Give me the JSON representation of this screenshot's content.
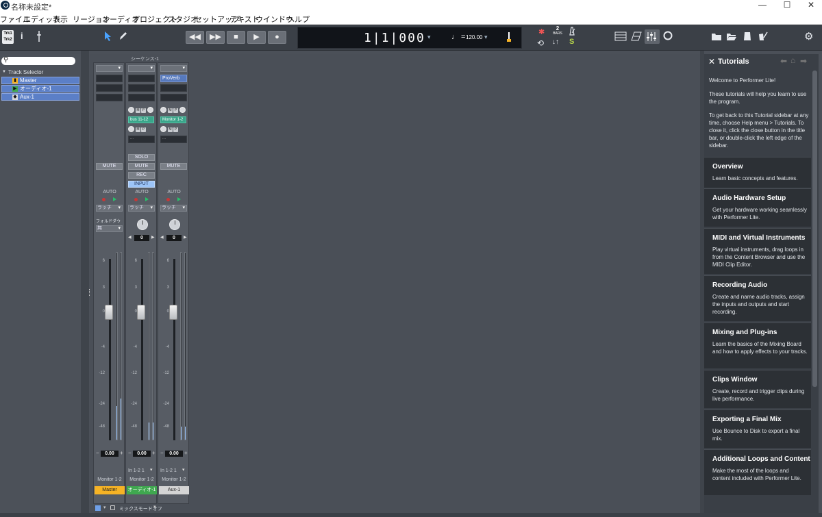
{
  "window": {
    "title": "名称未設定*",
    "controls": [
      "—",
      "☐",
      "✕"
    ]
  },
  "menu": [
    "ファイル",
    "エディット",
    "表示",
    "リージョン",
    "オーディオ",
    "プロジェクト",
    "スタジオ",
    "セットアップ",
    "テキスト",
    "ウインドウ",
    "ヘルプ"
  ],
  "toolbar": {
    "trk_label_top": "Trk1",
    "trk_label_bottom": "Trk2",
    "info_label": "i",
    "time_position": "1|1|000",
    "time_dropdown": "▾",
    "tempo": "120.00",
    "bars_count": "2",
    "bars_label": "BARS",
    "s_label": "S"
  },
  "track_selector": {
    "search_placeholder": "",
    "label": "Track Selector",
    "tracks": [
      {
        "name": "Master",
        "color": "#f6b325"
      },
      {
        "name": "オーディオ-1",
        "color": "#3fa84f"
      },
      {
        "name": "Aux-1",
        "color": "#d9d9d9"
      }
    ]
  },
  "mixer": {
    "sequence_label": "シーケンス-1",
    "strips": [
      {
        "name": "Master",
        "name_color": "#f6b325",
        "insert": "",
        "mute": "MUTE",
        "auto": "AUTO",
        "mode": "ラッチ",
        "fold": "フォルドダウン",
        "fold_value": "無",
        "volume": "0.00",
        "output": "Monitor 1-2",
        "input": "",
        "meter_left": 0.18,
        "meter_right": 0.22
      },
      {
        "name": "オーディオ-1",
        "name_color": "#3fa84f",
        "insert": "",
        "send_name": "bus 11-12",
        "solo": "SOLO",
        "mute": "MUTE",
        "rec": "REC",
        "input_btn": "INPUT",
        "auto": "AUTO",
        "mode": "ラッチ",
        "pan": "0",
        "volume": "0.00",
        "input": "In 1-2 1",
        "output": "Monitor 1-2",
        "meter_left": 0.09,
        "meter_right": 0.09
      },
      {
        "name": "Aux-1",
        "name_color": "#d4d4d4",
        "insert": "ProVerb",
        "send_name": "Monitor 1-2",
        "mute": "MUTE",
        "auto": "AUTO",
        "mode": "ラッチ",
        "pan": "0",
        "volume": "0.00",
        "input": "In 1-2 1",
        "output": "Monitor 1-2",
        "meter_left": 0.07,
        "meter_right": 0.07
      }
    ],
    "scale_ticks": [
      "6",
      "3",
      "0",
      "-4",
      "-12",
      "-24",
      "-48"
    ],
    "bottom_mode": "ミックスモードオフ"
  },
  "tutorials": {
    "title": "Tutorials",
    "intro1": "Welcome to Performer Lite!",
    "intro2": "These tutorials will help you learn to use the program.",
    "intro3": "To get back to this Tutorial sidebar at any time, choose Help menu > Tutorials. To close it, click the close button in the title bar, or double-click the left edge of the sidebar.",
    "cards": [
      {
        "title": "Overview",
        "desc": "Learn basic concepts and features."
      },
      {
        "title": "Audio Hardware Setup",
        "desc": "Get your hardware working seamlessly with Performer Lite."
      },
      {
        "title": "MIDI and Virtual Instruments",
        "desc": "Play virtual instruments, drag loops in from the Content Browser and use the MIDI Clip Editor."
      },
      {
        "title": "Recording Audio",
        "desc": "Create and name audio tracks, assign the inputs and outputs and start recording."
      },
      {
        "title": "Mixing and Plug-ins",
        "desc": "Learn the basics of the Mixing Board and how to apply effects to your tracks."
      },
      {
        "title": "Clips Window",
        "desc": "Create, record and trigger clips during live performance."
      },
      {
        "title": "Exporting a Final Mix",
        "desc": "Use Bounce to Disk to export a final mix."
      },
      {
        "title": "Additional Loops and Content",
        "desc": "Make the most of the loops and content included with Performer Lite."
      }
    ]
  }
}
